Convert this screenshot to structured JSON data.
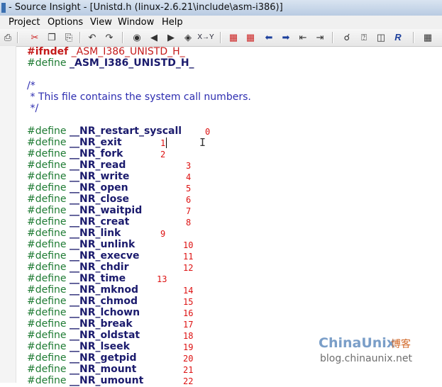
{
  "window": {
    "title": "- Source Insight - [Unistd.h (linux-2.6.21\\include\\asm-i386)]"
  },
  "menu": {
    "items": [
      "Project",
      "Options",
      "View",
      "Window",
      "Help"
    ]
  },
  "toolbar": {
    "xy_label": "X→Y"
  },
  "code": {
    "ifndef_kw": "#ifndef",
    "ifndef_macro": "_ASM_I386_UNISTD_H_",
    "define_kw": "#define",
    "guard_macro": "_ASM_I386_UNISTD_H_",
    "comment_open": "/*",
    "comment_body": " * This file contains the system call numbers.",
    "comment_close": " */",
    "defines": [
      {
        "name": "__NR_restart_syscall",
        "value": "0"
      },
      {
        "name": "__NR_exit",
        "value": "1"
      },
      {
        "name": "__NR_fork",
        "value": "2"
      },
      {
        "name": "__NR_read",
        "value": "3"
      },
      {
        "name": "__NR_write",
        "value": "4"
      },
      {
        "name": "__NR_open",
        "value": "5"
      },
      {
        "name": "__NR_close",
        "value": "6"
      },
      {
        "name": "__NR_waitpid",
        "value": "7"
      },
      {
        "name": "__NR_creat",
        "value": "8"
      },
      {
        "name": "__NR_link",
        "value": "9"
      },
      {
        "name": "__NR_unlink",
        "value": "10"
      },
      {
        "name": "__NR_execve",
        "value": "11"
      },
      {
        "name": "__NR_chdir",
        "value": "12"
      },
      {
        "name": "__NR_time",
        "value": "13"
      },
      {
        "name": "__NR_mknod",
        "value": "14"
      },
      {
        "name": "__NR_chmod",
        "value": "15"
      },
      {
        "name": "__NR_lchown",
        "value": "16"
      },
      {
        "name": "__NR_break",
        "value": "17"
      },
      {
        "name": "__NR_oldstat",
        "value": "18"
      },
      {
        "name": "__NR_lseek",
        "value": "19"
      },
      {
        "name": "__NR_getpid",
        "value": "20"
      },
      {
        "name": "__NR_mount",
        "value": "21"
      },
      {
        "name": "__NR_umount",
        "value": "22"
      }
    ]
  },
  "watermark": {
    "brand": "ChinaUnix",
    "brand_cn": "博客",
    "url": "blog.chinaunix.net"
  },
  "colors": {
    "preprocessor": "#1e7b33",
    "macro_name": "#1b1b6d",
    "number": "#d11111",
    "comment": "#2d2db0"
  }
}
